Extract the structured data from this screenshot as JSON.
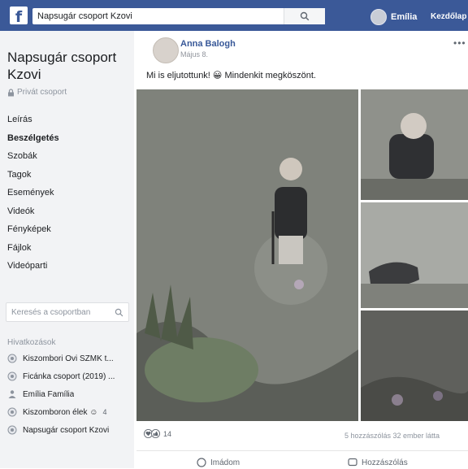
{
  "topbar": {
    "logo": "f",
    "search_value": "Napsugár csoport Kzovi",
    "user_name": "Emília",
    "home_label": "Kezdőlap"
  },
  "sidebar": {
    "group_name": "Napsugár csoport Kzovi",
    "privacy": "Privát csoport",
    "nav": [
      {
        "label": "Leírás",
        "active": false
      },
      {
        "label": "Beszélgetés",
        "active": true
      },
      {
        "label": "Szobák",
        "active": false
      },
      {
        "label": "Tagok",
        "active": false
      },
      {
        "label": "Események",
        "active": false
      },
      {
        "label": "Videók",
        "active": false
      },
      {
        "label": "Fényképek",
        "active": false
      },
      {
        "label": "Fájlok",
        "active": false
      },
      {
        "label": "Videóparti",
        "active": false
      }
    ],
    "search_placeholder": "Keresés a csoportban",
    "shortcuts_label": "Hivatkozások",
    "shortcuts": [
      {
        "label": "Kiszombori Ovi SZMK t...",
        "icon": "group-icon",
        "count": ""
      },
      {
        "label": "Ficánka csoport (2019) ...",
        "icon": "group-icon",
        "count": ""
      },
      {
        "label": "Emília Família",
        "icon": "family-icon",
        "count": ""
      },
      {
        "label": "Kiszomboron élek ☺",
        "icon": "group-icon",
        "count": "4"
      },
      {
        "label": "Napsugár csoport Kzovi",
        "icon": "group-icon",
        "count": ""
      }
    ]
  },
  "post": {
    "author": "Anna Balogh",
    "date": "Május 8.",
    "menu": "•••",
    "text": "Mi is eljutottunk! 😀 Mindenkit megköszönt.",
    "reaction_count": "14",
    "stats": "5 hozzászólás  32 ember látta",
    "action_react": "Imádom",
    "action_comment": "Hozzászólás"
  },
  "colors": {
    "brand": "#3b5998",
    "sidebar_bg": "#f2f3f5",
    "link": "#385898"
  }
}
